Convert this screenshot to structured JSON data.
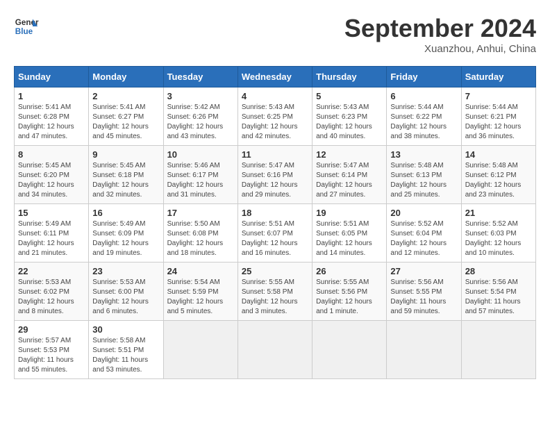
{
  "header": {
    "logo_line1": "General",
    "logo_line2": "Blue",
    "month": "September 2024",
    "location": "Xuanzhou, Anhui, China"
  },
  "days_of_week": [
    "Sunday",
    "Monday",
    "Tuesday",
    "Wednesday",
    "Thursday",
    "Friday",
    "Saturday"
  ],
  "weeks": [
    [
      {
        "num": "1",
        "info": "Sunrise: 5:41 AM\nSunset: 6:28 PM\nDaylight: 12 hours\nand 47 minutes."
      },
      {
        "num": "2",
        "info": "Sunrise: 5:41 AM\nSunset: 6:27 PM\nDaylight: 12 hours\nand 45 minutes."
      },
      {
        "num": "3",
        "info": "Sunrise: 5:42 AM\nSunset: 6:26 PM\nDaylight: 12 hours\nand 43 minutes."
      },
      {
        "num": "4",
        "info": "Sunrise: 5:43 AM\nSunset: 6:25 PM\nDaylight: 12 hours\nand 42 minutes."
      },
      {
        "num": "5",
        "info": "Sunrise: 5:43 AM\nSunset: 6:23 PM\nDaylight: 12 hours\nand 40 minutes."
      },
      {
        "num": "6",
        "info": "Sunrise: 5:44 AM\nSunset: 6:22 PM\nDaylight: 12 hours\nand 38 minutes."
      },
      {
        "num": "7",
        "info": "Sunrise: 5:44 AM\nSunset: 6:21 PM\nDaylight: 12 hours\nand 36 minutes."
      }
    ],
    [
      {
        "num": "8",
        "info": "Sunrise: 5:45 AM\nSunset: 6:20 PM\nDaylight: 12 hours\nand 34 minutes."
      },
      {
        "num": "9",
        "info": "Sunrise: 5:45 AM\nSunset: 6:18 PM\nDaylight: 12 hours\nand 32 minutes."
      },
      {
        "num": "10",
        "info": "Sunrise: 5:46 AM\nSunset: 6:17 PM\nDaylight: 12 hours\nand 31 minutes."
      },
      {
        "num": "11",
        "info": "Sunrise: 5:47 AM\nSunset: 6:16 PM\nDaylight: 12 hours\nand 29 minutes."
      },
      {
        "num": "12",
        "info": "Sunrise: 5:47 AM\nSunset: 6:14 PM\nDaylight: 12 hours\nand 27 minutes."
      },
      {
        "num": "13",
        "info": "Sunrise: 5:48 AM\nSunset: 6:13 PM\nDaylight: 12 hours\nand 25 minutes."
      },
      {
        "num": "14",
        "info": "Sunrise: 5:48 AM\nSunset: 6:12 PM\nDaylight: 12 hours\nand 23 minutes."
      }
    ],
    [
      {
        "num": "15",
        "info": "Sunrise: 5:49 AM\nSunset: 6:11 PM\nDaylight: 12 hours\nand 21 minutes."
      },
      {
        "num": "16",
        "info": "Sunrise: 5:49 AM\nSunset: 6:09 PM\nDaylight: 12 hours\nand 19 minutes."
      },
      {
        "num": "17",
        "info": "Sunrise: 5:50 AM\nSunset: 6:08 PM\nDaylight: 12 hours\nand 18 minutes."
      },
      {
        "num": "18",
        "info": "Sunrise: 5:51 AM\nSunset: 6:07 PM\nDaylight: 12 hours\nand 16 minutes."
      },
      {
        "num": "19",
        "info": "Sunrise: 5:51 AM\nSunset: 6:05 PM\nDaylight: 12 hours\nand 14 minutes."
      },
      {
        "num": "20",
        "info": "Sunrise: 5:52 AM\nSunset: 6:04 PM\nDaylight: 12 hours\nand 12 minutes."
      },
      {
        "num": "21",
        "info": "Sunrise: 5:52 AM\nSunset: 6:03 PM\nDaylight: 12 hours\nand 10 minutes."
      }
    ],
    [
      {
        "num": "22",
        "info": "Sunrise: 5:53 AM\nSunset: 6:02 PM\nDaylight: 12 hours\nand 8 minutes."
      },
      {
        "num": "23",
        "info": "Sunrise: 5:53 AM\nSunset: 6:00 PM\nDaylight: 12 hours\nand 6 minutes."
      },
      {
        "num": "24",
        "info": "Sunrise: 5:54 AM\nSunset: 5:59 PM\nDaylight: 12 hours\nand 5 minutes."
      },
      {
        "num": "25",
        "info": "Sunrise: 5:55 AM\nSunset: 5:58 PM\nDaylight: 12 hours\nand 3 minutes."
      },
      {
        "num": "26",
        "info": "Sunrise: 5:55 AM\nSunset: 5:56 PM\nDaylight: 12 hours\nand 1 minute."
      },
      {
        "num": "27",
        "info": "Sunrise: 5:56 AM\nSunset: 5:55 PM\nDaylight: 11 hours\nand 59 minutes."
      },
      {
        "num": "28",
        "info": "Sunrise: 5:56 AM\nSunset: 5:54 PM\nDaylight: 11 hours\nand 57 minutes."
      }
    ],
    [
      {
        "num": "29",
        "info": "Sunrise: 5:57 AM\nSunset: 5:53 PM\nDaylight: 11 hours\nand 55 minutes."
      },
      {
        "num": "30",
        "info": "Sunrise: 5:58 AM\nSunset: 5:51 PM\nDaylight: 11 hours\nand 53 minutes."
      },
      {
        "num": "",
        "info": ""
      },
      {
        "num": "",
        "info": ""
      },
      {
        "num": "",
        "info": ""
      },
      {
        "num": "",
        "info": ""
      },
      {
        "num": "",
        "info": ""
      }
    ]
  ]
}
